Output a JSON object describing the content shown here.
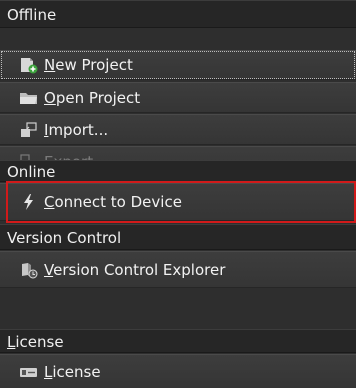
{
  "sections": {
    "offline": {
      "header": "Offline",
      "items": [
        {
          "access_key": "N",
          "rest": "ew Project",
          "icon": "new-project-icon"
        },
        {
          "access_key": "O",
          "rest": "pen Project",
          "icon": "folder-icon"
        },
        {
          "access_key": "I",
          "rest": "mport...",
          "icon": "import-icon"
        },
        {
          "access_key": "E",
          "rest": "xport...",
          "icon": "export-icon"
        }
      ]
    },
    "online": {
      "header": "Online",
      "items": [
        {
          "access_key": "C",
          "rest": "onnect to Device",
          "icon": "lightning-icon"
        }
      ]
    },
    "version_control": {
      "header": "Version Control",
      "items": [
        {
          "access_key": "V",
          "rest": "ersion Control Explorer",
          "icon": "version-control-icon"
        }
      ]
    },
    "license": {
      "header_key": "L",
      "header_rest": "icense",
      "items": [
        {
          "access_key": "L",
          "rest": "icense",
          "icon": "license-key-icon"
        }
      ]
    }
  },
  "colors": {
    "highlight": "#d11a1a",
    "background": "#2e2e2e",
    "header_bg": "#262626",
    "item_bg": "#3a3a3a"
  }
}
